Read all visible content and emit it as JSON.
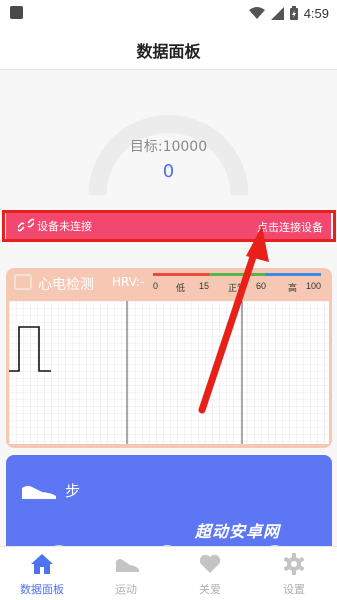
{
  "status_bar": {
    "time": "4:59"
  },
  "header": {
    "title": "数据面板"
  },
  "goal": {
    "label": "目标:10000",
    "value": "0",
    "progress_fraction": 0
  },
  "device_banner": {
    "status": "设备未连接",
    "action": "点击连接设备"
  },
  "ecg": {
    "title": "心电检测",
    "hrv_label": "HRV:-",
    "scale_labels": [
      "0",
      "低",
      "15",
      "正常",
      "60",
      "高",
      "100"
    ]
  },
  "steps": {
    "label": "步"
  },
  "watermark": "超动安卓网",
  "bottom_nav": [
    {
      "label": "数据面板",
      "icon": "home-icon",
      "active": true
    },
    {
      "label": "运动",
      "icon": "shoe-icon",
      "active": false
    },
    {
      "label": "关爱",
      "icon": "heart-icon",
      "active": false
    },
    {
      "label": "设置",
      "icon": "gear-icon",
      "active": false
    }
  ],
  "colors": {
    "accent": "#4f72f0",
    "banner": "#f2476e",
    "annotation": "#e8201a",
    "ecg_card": "#f6c8b4",
    "steps_card": "#5c76f4",
    "scale_low": "#e84a3a",
    "scale_normal": "#55b54a",
    "scale_high": "#3a8be8"
  }
}
